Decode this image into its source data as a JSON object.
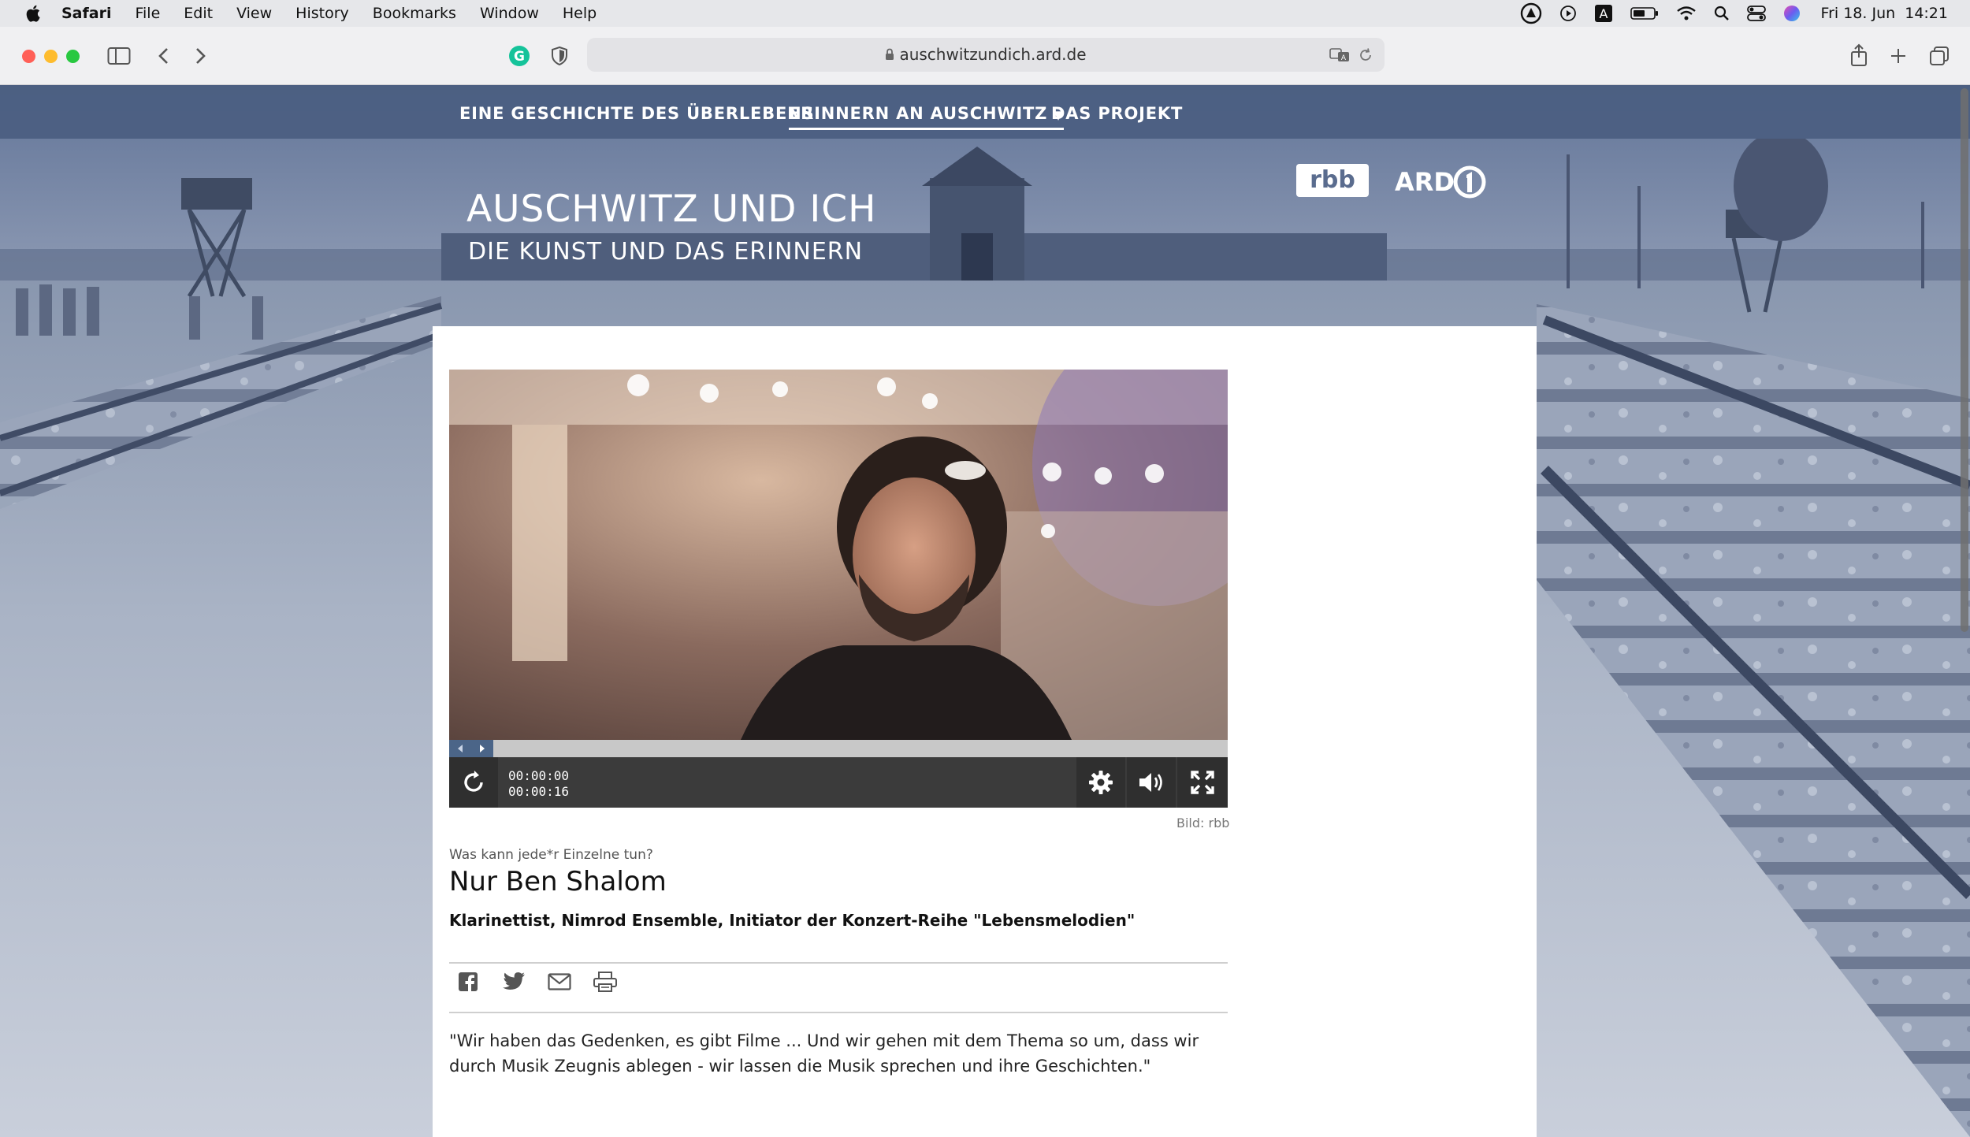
{
  "menubar": {
    "app": "Safari",
    "items": [
      "File",
      "Edit",
      "View",
      "History",
      "Bookmarks",
      "Window",
      "Help"
    ],
    "clock": "Fri 18. Jun  14:21"
  },
  "browser": {
    "url": "auschwitzundich.ard.de"
  },
  "nav": {
    "items": [
      "EINE GESCHICHTE DES ÜBERLEBENS",
      "ERINNERN AN AUSCHWITZ",
      "DAS PROJEKT"
    ],
    "active_index": 1
  },
  "hero": {
    "title": "AUSCHWITZ UND ICH",
    "subtitle": "DIE KUNST UND DAS ERINNERN",
    "logo_rbb": "rbb",
    "logo_ard": "ARD"
  },
  "video": {
    "time_current": "00:00:00",
    "time_total": "00:00:16",
    "progress": 0,
    "credit": "Bild: rbb"
  },
  "article": {
    "kicker": "Was kann jede*r Einzelne tun?",
    "headline": "Nur Ben Shalom",
    "subline": "Klarinettist, Nimrod Ensemble, Initiator der Konzert-Reihe \"Lebensmelodien\"",
    "quote": "\"Wir haben das Gedenken, es gibt Filme ... Und wir gehen mit dem Thema so um, dass wir durch Musik Zeugnis ablegen - wir lassen die Musik sprechen und ihre Geschichten.\""
  },
  "share_icons": [
    "facebook-icon",
    "twitter-icon",
    "mail-icon",
    "print-icon"
  ],
  "colors": {
    "nav_bg": "#4c6082",
    "accent_blue": "#4b6588",
    "page_bg": "#ffffff"
  }
}
